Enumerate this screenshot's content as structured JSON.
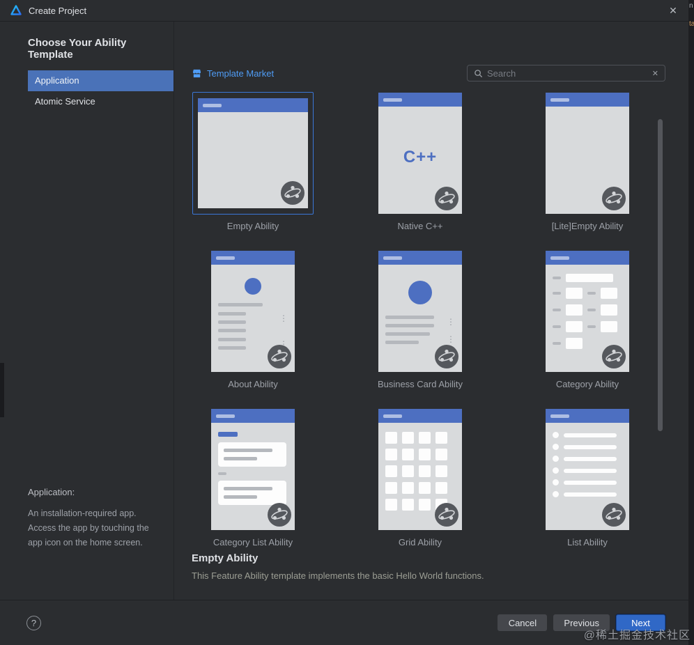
{
  "window": {
    "title": "Create Project",
    "close_glyph": "✕"
  },
  "background": {
    "edge_fragments": [
      "n",
      "ta"
    ]
  },
  "sidebar": {
    "heading": "Choose Your Ability Template",
    "items": [
      {
        "label": "Application",
        "selected": true
      },
      {
        "label": "Atomic Service",
        "selected": false
      }
    ],
    "info_title": "Application:",
    "info_text": "An installation-required app.\nAccess the app by touching the\napp icon on the home screen."
  },
  "main": {
    "template_market_label": "Template Market",
    "search_placeholder": "Search",
    "clear_glyph": "✕",
    "cpp_logo": "C++",
    "templates": [
      {
        "label": "Empty Ability",
        "variant": "empty",
        "selected": true
      },
      {
        "label": "Native C++",
        "variant": "native-cpp",
        "selected": false
      },
      {
        "label": "[Lite]Empty Ability",
        "variant": "empty",
        "selected": false
      },
      {
        "label": "About Ability",
        "variant": "about",
        "selected": false
      },
      {
        "label": "Business Card Ability",
        "variant": "business-card",
        "selected": false
      },
      {
        "label": "Category Ability",
        "variant": "category",
        "selected": false
      },
      {
        "label": "Category List Ability",
        "variant": "category-list",
        "selected": false
      },
      {
        "label": "Grid Ability",
        "variant": "grid",
        "selected": false
      },
      {
        "label": "List Ability",
        "variant": "list",
        "selected": false
      }
    ],
    "detail": {
      "title": "Empty Ability",
      "description": "This Feature Ability template implements the basic Hello World functions."
    }
  },
  "footer": {
    "help_glyph": "?",
    "buttons": [
      {
        "label": "Cancel",
        "primary": false
      },
      {
        "label": "Previous",
        "primary": false
      },
      {
        "label": "Next",
        "primary": true
      }
    ]
  },
  "watermark": "@稀土掘金技术社区",
  "colors": {
    "dialog_bg": "#2b2d30",
    "selection_blue": "#4a72b8",
    "card_outline_blue": "#3b77d8",
    "card_header_blue": "#4d6fc1",
    "link_blue": "#4f9cf5",
    "primary_button_blue": "#3068c6",
    "mockup_body": "#d8dadc"
  }
}
